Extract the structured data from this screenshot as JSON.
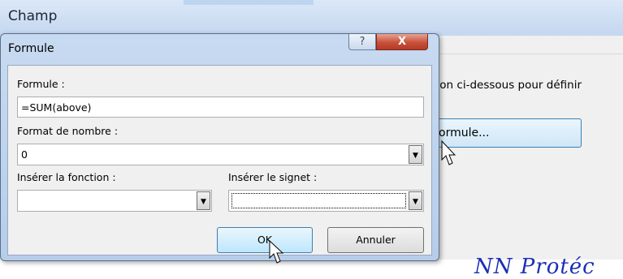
{
  "background_window": {
    "title": "Champ",
    "description": "ton ci-dessous pour définir",
    "formule_button_label": "ormule...",
    "footer_text": "NN Protéc"
  },
  "dialog": {
    "title": "Formule",
    "help_label": "?",
    "close_label": "X",
    "formula_label": "Formule :",
    "formula_value": "=SUM(above)",
    "number_format_label": "Format de nombre :",
    "number_format_value": "0",
    "insert_function_label": "Insérer la fonction :",
    "insert_function_value": "",
    "insert_bookmark_label": "Insérer le signet :",
    "insert_bookmark_value": "",
    "ok_label": "OK",
    "cancel_label": "Annuler"
  },
  "colors": {
    "accent": "#3c7fb1",
    "close_red": "#c8503b",
    "footer_blue": "#1c2fb8"
  }
}
